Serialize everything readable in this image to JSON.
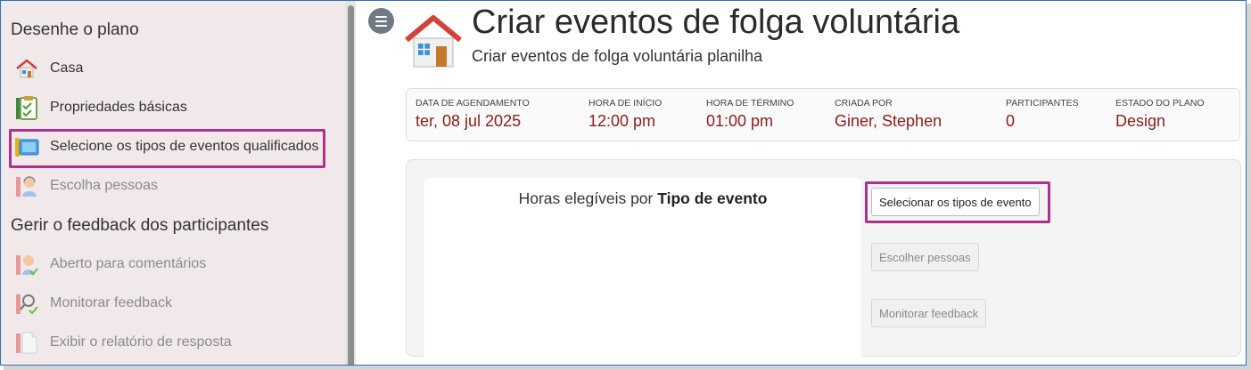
{
  "sidebar": {
    "section_design": "Desenhe o plano",
    "section_feedback": "Gerir o feedback dos participantes",
    "design_items": [
      {
        "label": "Casa",
        "icon": "home-icon"
      },
      {
        "label": "Propriedades básicas",
        "icon": "clipboard-check-icon"
      },
      {
        "label": "Selecione os tipos de eventos qualificados",
        "icon": "event-types-icon"
      },
      {
        "label": "Escolha pessoas",
        "icon": "person-headset-icon"
      }
    ],
    "feedback_items": [
      {
        "label": "Aberto para comentários",
        "icon": "person-check-icon"
      },
      {
        "label": "Monitorar feedback",
        "icon": "magnifier-check-icon"
      },
      {
        "label": "Exibir o relatório de resposta",
        "icon": "report-document-icon"
      }
    ]
  },
  "header": {
    "title": "Criar eventos de folga voluntária",
    "subtitle": "Criar eventos de folga voluntária planilha"
  },
  "info": [
    {
      "label": "Data de agendamento",
      "value": "ter, 08 jul 2025"
    },
    {
      "label": "Hora de início",
      "value": "12:00 pm"
    },
    {
      "label": "Hora de término",
      "value": "01:00 pm"
    },
    {
      "label": "Criada por",
      "value": "Giner, Stephen"
    },
    {
      "label": "Participantes",
      "value": "0"
    },
    {
      "label": "Estado do plano",
      "value": "Design"
    }
  ],
  "chart": {
    "title_prefix": "Horas elegíveis por ",
    "title_bold": "Tipo de evento"
  },
  "actions": {
    "select_event_types": "Selecionar os tipos de evento",
    "choose_people": "Escolher pessoas",
    "monitor_feedback": "Monitorar feedback"
  },
  "colors": {
    "accent_value": "#8a1c1c",
    "highlight": "#b0308f",
    "sidebar_bg": "#f1e9e9"
  }
}
